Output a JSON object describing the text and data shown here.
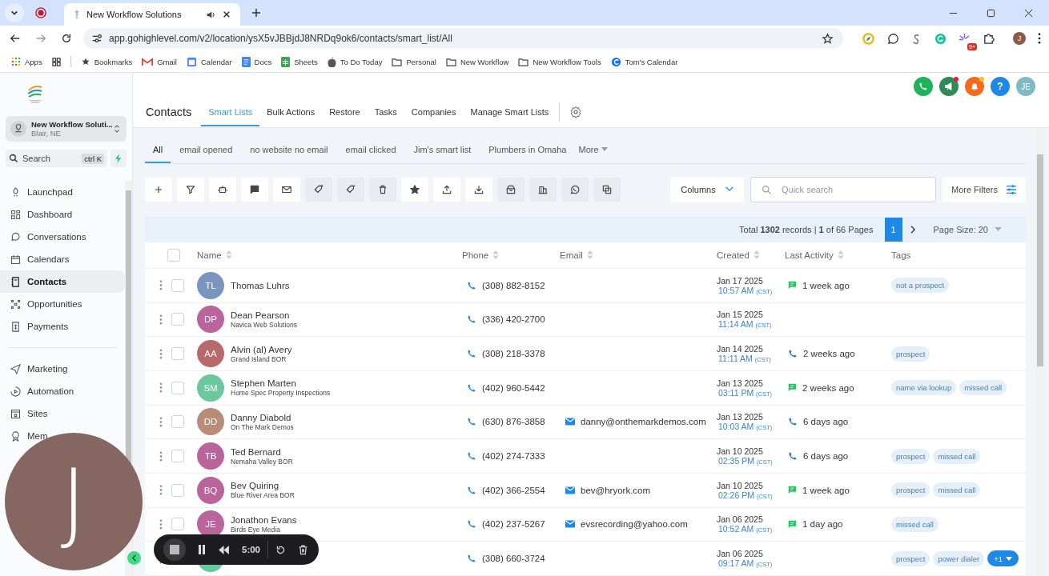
{
  "browser": {
    "tabs": [
      {
        "title": "New Workflow Solutions",
        "selected": true
      }
    ],
    "url": "app.gohighlevel.com/v2/location/ysX5vJBBjdJ8NRDq9ok6/contacts/smart_list/All",
    "extension_badge": "9+",
    "profile": "J",
    "bookmarks": [
      {
        "label": "Apps",
        "kind": "apps"
      },
      {
        "label": "Bookmarks",
        "kind": "star"
      },
      {
        "label": "Gmail",
        "kind": "gmail"
      },
      {
        "label": "Calendar",
        "kind": "calendar"
      },
      {
        "label": "Docs",
        "kind": "docs"
      },
      {
        "label": "Sheets",
        "kind": "sheets"
      },
      {
        "label": "To Do Today",
        "kind": "apple"
      },
      {
        "label": "Personal",
        "kind": "folder"
      },
      {
        "label": "New Workflow",
        "kind": "folder"
      },
      {
        "label": "New Workflow Tools",
        "kind": "folder"
      },
      {
        "label": "Tom's Calendar",
        "kind": "site"
      }
    ]
  },
  "sidebar": {
    "account": {
      "name": "New Workflow Soluti...",
      "location": "Blair, NE"
    },
    "search": {
      "label": "Search",
      "shortcut": "ctrl K"
    },
    "groups": [
      [
        {
          "label": "Launchpad",
          "selected": false
        },
        {
          "label": "Dashboard",
          "selected": false
        },
        {
          "label": "Conversations",
          "selected": false
        },
        {
          "label": "Calendars",
          "selected": false
        },
        {
          "label": "Contacts",
          "selected": true
        },
        {
          "label": "Opportunities",
          "selected": false
        },
        {
          "label": "Payments",
          "selected": false
        }
      ],
      [
        {
          "label": "Marketing",
          "selected": false
        },
        {
          "label": "Automation",
          "selected": false
        },
        {
          "label": "Sites",
          "selected": false
        },
        {
          "label": "Mem",
          "selected": false
        }
      ]
    ]
  },
  "header": {
    "title": "Contacts",
    "help": "?",
    "user_initials": "JE",
    "tabs": [
      {
        "label": "Smart Lists",
        "selected": true
      },
      {
        "label": "Bulk Actions",
        "selected": false
      },
      {
        "label": "Restore",
        "selected": false
      },
      {
        "label": "Tasks",
        "selected": false
      },
      {
        "label": "Companies",
        "selected": false
      },
      {
        "label": "Manage Smart Lists",
        "selected": false
      }
    ]
  },
  "smart_lists": {
    "tabs": [
      {
        "label": "All",
        "selected": true
      },
      {
        "label": "email opened",
        "selected": false
      },
      {
        "label": "no website no email",
        "selected": false
      },
      {
        "label": "email clicked",
        "selected": false
      },
      {
        "label": "Jim's smart list",
        "selected": false
      },
      {
        "label": "Plumbers in Omaha",
        "selected": false
      }
    ],
    "more": "More"
  },
  "toolbar": {
    "columns": "Columns",
    "search_placeholder": "Quick search",
    "more_filters": "More Filters"
  },
  "pagination": {
    "summary": "Total **1302** records | **1** of 66 Pages",
    "page": "1",
    "page_size": "Page Size: 20"
  },
  "table": {
    "all_checked": false,
    "columns": [
      {
        "label": "Name",
        "sortable": true
      },
      {
        "label": "Phone",
        "sortable": true
      },
      {
        "label": "Email",
        "sortable": true
      },
      {
        "label": "Created",
        "sortable": true
      },
      {
        "label": "Last Activity",
        "sortable": true
      },
      {
        "label": "Tags",
        "sortable": false
      }
    ],
    "rows": [
      {
        "checked": false,
        "initials": "TL",
        "color": "#7a95bd",
        "name": "Thomas Luhrs",
        "phone": "(308) 882-8152",
        "date": "Jan 17 2025",
        "time": "10:57 AM",
        "tz": "(CST)",
        "activity": {
          "kind": "sms",
          "text": "1 week ago"
        },
        "tags": [
          "not a prospect"
        ]
      },
      {
        "checked": false,
        "initials": "DP",
        "color": "#b9649b",
        "name": "Dean Pearson",
        "company": "Navica Web Solutions",
        "phone": "(336) 420-2700",
        "date": "Jan 15 2025",
        "time": "11:14 AM",
        "tz": "(CST)",
        "tags": []
      },
      {
        "checked": false,
        "initials": "AA",
        "color": "#b86a6a",
        "name": "Alvin (al) Avery",
        "company": "Grand Island BOR",
        "phone": "(308) 218-3378",
        "date": "Jan 14 2025",
        "time": "11:11 AM",
        "tz": "(CST)",
        "activity": {
          "kind": "call",
          "text": "2 weeks ago"
        },
        "tags": [
          "prospect"
        ]
      },
      {
        "checked": false,
        "initials": "SM",
        "color": "#6dc79c",
        "name": "Stephen Marten",
        "company": "Home Spec Property Inspections",
        "phone": "(402) 960-5442",
        "date": "Jan 13 2025",
        "time": "03:11 PM",
        "tz": "(CST)",
        "activity": {
          "kind": "sms",
          "text": "2 weeks ago"
        },
        "tags": [
          "name via lookup",
          "missed call"
        ]
      },
      {
        "checked": false,
        "initials": "DD",
        "color": "#b98c7a",
        "name": "Danny Diabold",
        "company": "On The Mark Demos",
        "phone": "(630) 876-3858",
        "email": "danny@onthemarkdemos.com",
        "date": "Jan 13 2025",
        "time": "10:03 AM",
        "tz": "(CST)",
        "activity": {
          "kind": "call",
          "text": "6 days ago"
        },
        "tags": []
      },
      {
        "checked": false,
        "initials": "TB",
        "color": "#b9649b",
        "name": "Ted Bernard",
        "company": "Nemaha Valley BOR",
        "phone": "(402) 274-7333",
        "date": "Jan 10 2025",
        "time": "02:35 PM",
        "tz": "(CST)",
        "activity": {
          "kind": "call",
          "text": "6 days ago"
        },
        "tags": [
          "prospect",
          "missed call"
        ]
      },
      {
        "checked": false,
        "initials": "BQ",
        "color": "#b9649b",
        "name": "Bev Quiring",
        "company": "Blue River Area BOR",
        "phone": "(402) 366-2554",
        "email": "bev@hryork.com",
        "date": "Jan 10 2025",
        "time": "02:26 PM",
        "tz": "(CST)",
        "activity": {
          "kind": "sms",
          "text": "1 week ago"
        },
        "tags": [
          "prospect",
          "missed call"
        ]
      },
      {
        "checked": false,
        "initials": "JE",
        "color": "#b9649b",
        "name": "Jonathon Evans",
        "company": "Birds Eye Media",
        "phone": "(402) 237-5267",
        "email": "evsrecording@yahoo.com",
        "date": "Jan 06 2025",
        "time": "10:52 AM",
        "tz": "(CST)",
        "activity": {
          "kind": "sms",
          "text": "1 day ago"
        },
        "tags": [
          "missed call"
        ]
      },
      {
        "color": "#6dc79c",
        "phone": "(308) 660-3724",
        "date": "Jan 06 2025",
        "time": "09:17 AM",
        "tz": "(CST)",
        "tags": [
          "prospect",
          "power dialer"
        ],
        "more_tags": "+1"
      }
    ]
  },
  "recorder": {
    "time": "5:00"
  },
  "camera": {
    "initial": "J"
  }
}
